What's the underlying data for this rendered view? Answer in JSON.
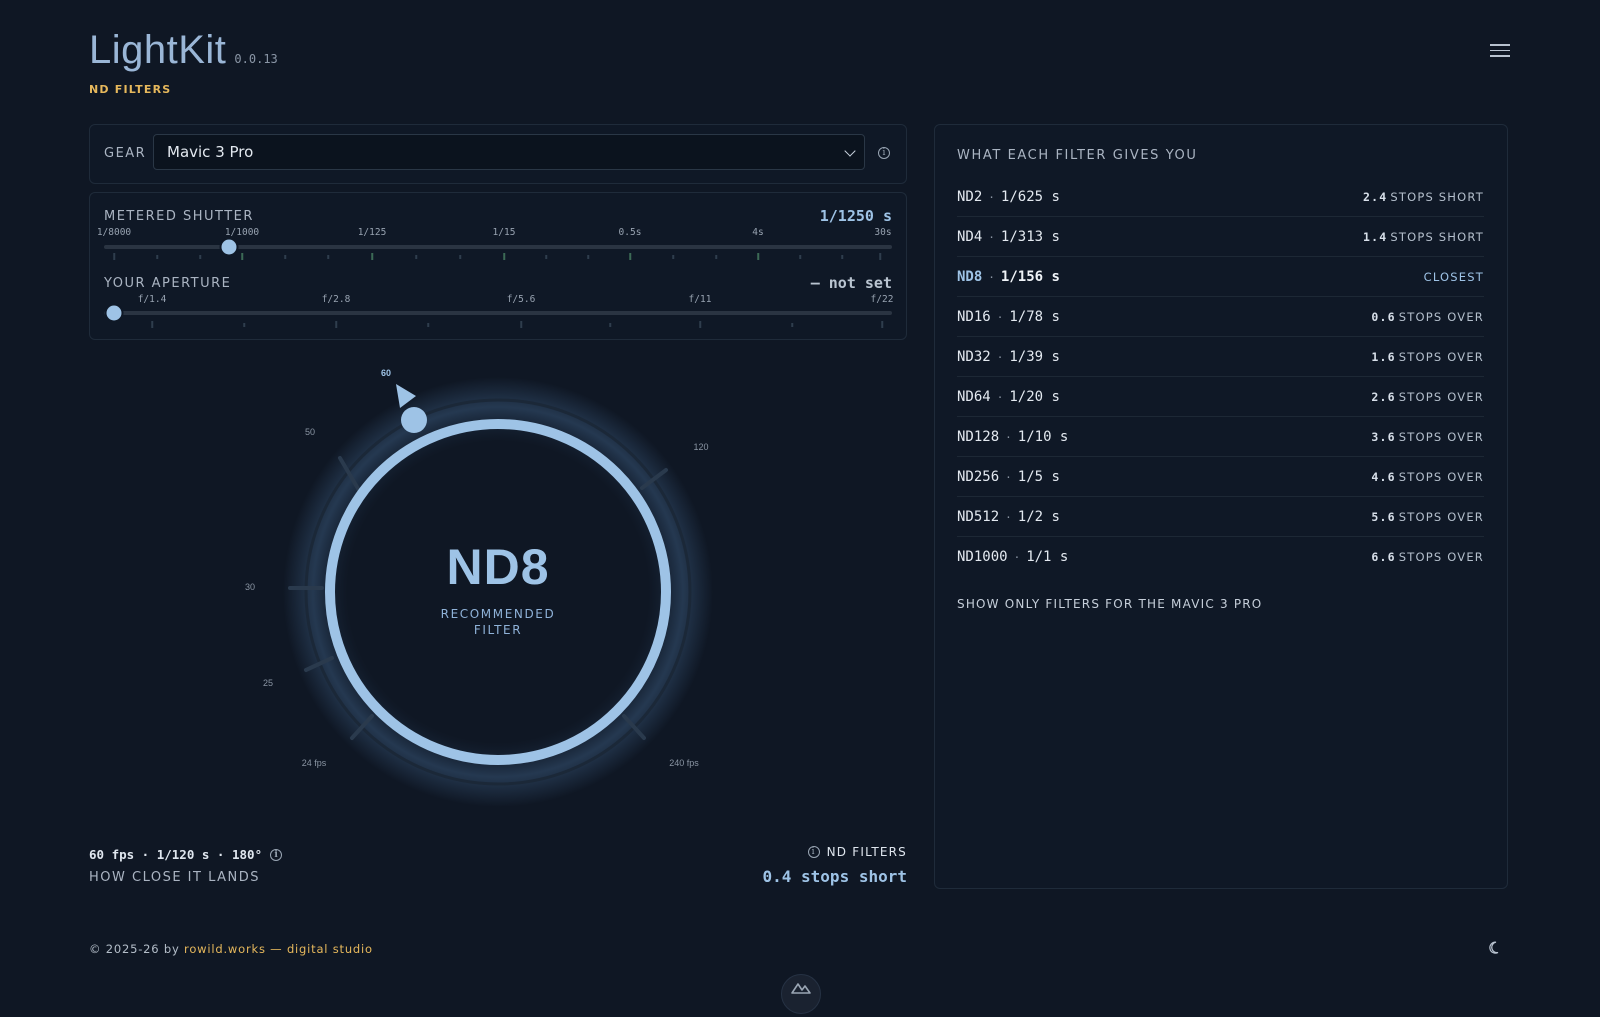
{
  "app": {
    "name": "LightKit",
    "version": "0.0.13",
    "section": "ND FILTERS"
  },
  "gear": {
    "label": "GEAR",
    "selected": "Mavic 3 Pro"
  },
  "shutter": {
    "label": "METERED SHUTTER",
    "value": "1/1250 s",
    "ticks": [
      "1/8000",
      "1/1000",
      "1/125",
      "1/15",
      "0.5s",
      "4s",
      "30s"
    ]
  },
  "aperture": {
    "label": "YOUR APERTURE",
    "value": "— not set",
    "ticks": [
      "f/1.4",
      "f/2.8",
      "f/5.6",
      "f/11",
      "f/22"
    ]
  },
  "dial": {
    "filter": "ND8",
    "caption_line1": "RECOMMENDED",
    "caption_line2": "FILTER",
    "labels": {
      "l60": "60",
      "l50": "50",
      "l120": "120",
      "l30": "30",
      "l25": "25",
      "l24": "24 fps",
      "l240": "240 fps"
    }
  },
  "readout": {
    "settings": "60 fps · 1/120 s · 180°",
    "how_close_label": "HOW CLOSE IT LANDS",
    "nd_link": "ND FILTERS",
    "result": "0.4 stops short"
  },
  "filters_panel": {
    "title": "WHAT EACH FILTER GIVES YOU",
    "rows": [
      {
        "name": "ND2",
        "shutter": "1/625 s",
        "stops": "2.4",
        "status": "STOPS SHORT"
      },
      {
        "name": "ND4",
        "shutter": "1/313 s",
        "stops": "1.4",
        "status": "STOPS SHORT"
      },
      {
        "name": "ND8",
        "shutter": "1/156 s",
        "stops": "",
        "status": "CLOSEST"
      },
      {
        "name": "ND16",
        "shutter": "1/78 s",
        "stops": "0.6",
        "status": "STOPS OVER"
      },
      {
        "name": "ND32",
        "shutter": "1/39 s",
        "stops": "1.6",
        "status": "STOPS OVER"
      },
      {
        "name": "ND64",
        "shutter": "1/20 s",
        "stops": "2.6",
        "status": "STOPS OVER"
      },
      {
        "name": "ND128",
        "shutter": "1/10 s",
        "stops": "3.6",
        "status": "STOPS OVER"
      },
      {
        "name": "ND256",
        "shutter": "1/5 s",
        "stops": "4.6",
        "status": "STOPS OVER"
      },
      {
        "name": "ND512",
        "shutter": "1/2 s",
        "stops": "5.6",
        "status": "STOPS OVER"
      },
      {
        "name": "ND1000",
        "shutter": "1/1 s",
        "stops": "6.6",
        "status": "STOPS OVER"
      }
    ],
    "show_only": "SHOW ONLY FILTERS FOR THE MAVIC 3 PRO"
  },
  "footer": {
    "prefix": "© 2025-26 by",
    "studio": "rowild.works — digital studio"
  },
  "icons": {
    "menu": "hamburger-icon",
    "info": "info-icon",
    "theme": "moon-icon",
    "badge": "mountain-logo-icon"
  },
  "colors": {
    "accent": "#9ec3e6",
    "brand": "#e6b85c",
    "background": "#0f1724"
  }
}
